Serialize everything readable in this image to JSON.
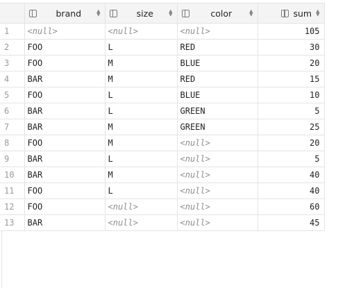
{
  "columns": [
    {
      "label": "brand",
      "icon": "column-icon"
    },
    {
      "label": "size",
      "icon": "column-icon"
    },
    {
      "label": "color",
      "icon": "column-icon"
    },
    {
      "label": "sum",
      "icon": "column-icon"
    }
  ],
  "sort_glyph_up": "▲",
  "sort_glyph_down": "▼",
  "rows": [
    {
      "n": "1",
      "brand": "<null>",
      "size": "<null>",
      "color": "<null>",
      "sum": "105"
    },
    {
      "n": "2",
      "brand": "FOO",
      "size": "L",
      "color": "RED",
      "sum": "30"
    },
    {
      "n": "3",
      "brand": "FOO",
      "size": "M",
      "color": "BLUE",
      "sum": "20"
    },
    {
      "n": "4",
      "brand": "BAR",
      "size": "M",
      "color": "RED",
      "sum": "15"
    },
    {
      "n": "5",
      "brand": "FOO",
      "size": "L",
      "color": "BLUE",
      "sum": "10"
    },
    {
      "n": "6",
      "brand": "BAR",
      "size": "L",
      "color": "GREEN",
      "sum": "5"
    },
    {
      "n": "7",
      "brand": "BAR",
      "size": "M",
      "color": "GREEN",
      "sum": "25"
    },
    {
      "n": "8",
      "brand": "FOO",
      "size": "M",
      "color": "<null>",
      "sum": "20"
    },
    {
      "n": "9",
      "brand": "BAR",
      "size": "L",
      "color": "<null>",
      "sum": "5"
    },
    {
      "n": "10",
      "brand": "BAR",
      "size": "M",
      "color": "<null>",
      "sum": "40"
    },
    {
      "n": "11",
      "brand": "FOO",
      "size": "L",
      "color": "<null>",
      "sum": "40"
    },
    {
      "n": "12",
      "brand": "FOO",
      "size": "<null>",
      "color": "<null>",
      "sum": "60"
    },
    {
      "n": "13",
      "brand": "BAR",
      "size": "<null>",
      "color": "<null>",
      "sum": "45"
    }
  ]
}
